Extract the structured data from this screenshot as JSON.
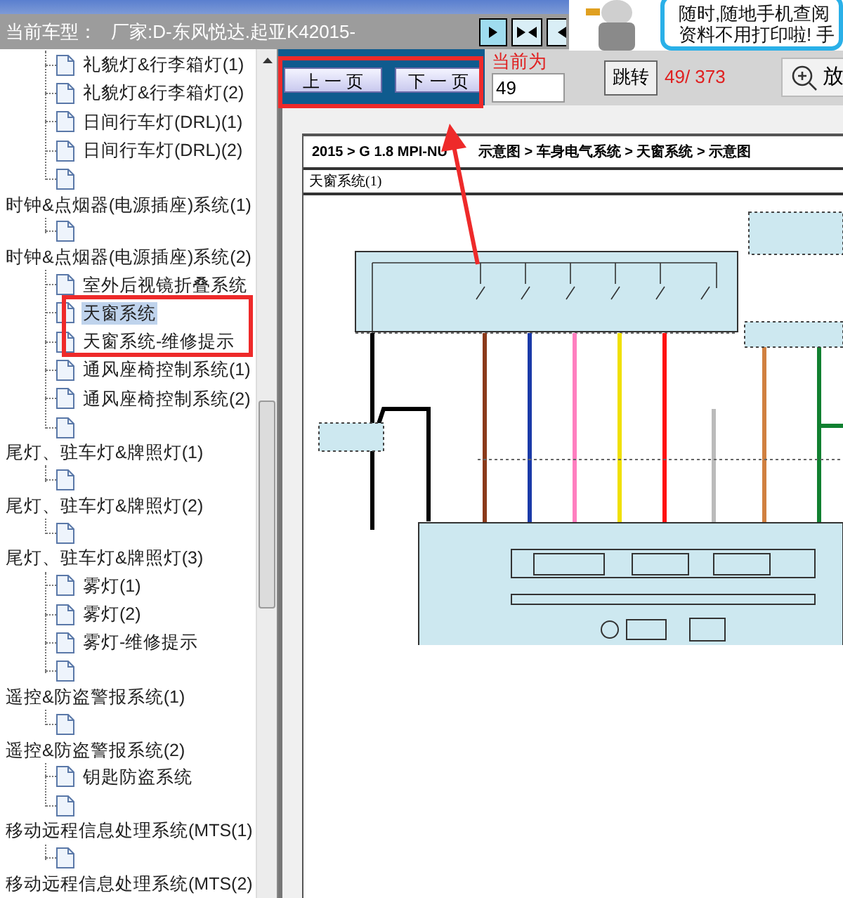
{
  "header": {
    "label": "当前车型：",
    "value": "厂家:D-东风悦达.起亚K42015-"
  },
  "ad": {
    "lines": [
      "随时,随地手机查阅",
      "资料不用打印啦! 手"
    ]
  },
  "tree": [
    {
      "children": [
        {
          "label": "礼貌灯&行李箱灯(1)",
          "selected": false
        },
        {
          "label": "礼貌灯&行李箱灯(2)",
          "selected": false
        },
        {
          "label": "日间行车灯(DRL)(1)",
          "selected": false
        },
        {
          "label": "日间行车灯(DRL)(2)",
          "selected": false
        },
        {
          "selected": false
        }
      ]
    },
    {
      "label": "时钟&点烟器(电源插座)系统(1)",
      "selected": false,
      "children": [
        {
          "selected": false
        }
      ]
    },
    {
      "label": "时钟&点烟器(电源插座)系统(2)",
      "selected": false,
      "children": [
        {
          "label": "室外后视镜折叠系统",
          "selected": false
        },
        {
          "label": "天窗系统",
          "selected": true
        },
        {
          "label": "天窗系统-维修提示",
          "selected": false
        },
        {
          "label": "通风座椅控制系统(1)",
          "selected": false
        },
        {
          "label": "通风座椅控制系统(2)",
          "selected": false
        },
        {
          "selected": false
        }
      ]
    },
    {
      "label": "尾灯、驻车灯&牌照灯(1)",
      "selected": false,
      "children": [
        {
          "selected": false
        }
      ]
    },
    {
      "label": "尾灯、驻车灯&牌照灯(2)",
      "selected": false,
      "children": [
        {
          "selected": false
        }
      ]
    },
    {
      "label": "尾灯、驻车灯&牌照灯(3)",
      "selected": false,
      "children": [
        {
          "label": "雾灯(1)",
          "selected": false
        },
        {
          "label": "雾灯(2)",
          "selected": false
        },
        {
          "label": "雾灯-维修提示",
          "selected": false
        },
        {
          "selected": false
        }
      ]
    },
    {
      "label": "遥控&防盗警报系统(1)",
      "selected": false,
      "children": [
        {
          "selected": false
        }
      ]
    },
    {
      "label": "遥控&防盗警报系统(2)",
      "selected": false,
      "children": [
        {
          "label": "钥匙防盗系统",
          "selected": false
        },
        {
          "selected": false
        }
      ]
    },
    {
      "label": "移动远程信息处理系统(MTS(1)",
      "selected": false,
      "children": [
        {
          "selected": false
        }
      ]
    },
    {
      "label": "移动远程信息处理系统(MTS(2)",
      "selected": false
    }
  ],
  "pager": {
    "prev_button": "上 一 页",
    "next_button": "下 一 页",
    "current_label": "当前为",
    "page_input": "49",
    "jump_button": "跳转",
    "page_count": "49/ 373",
    "zoom_button": "放"
  },
  "document": {
    "breadcrumb": [
      "2015 > G 1.8 MPI-NU",
      "示意图 > 车身电气系统 > 天窗系统 > 示意图"
    ],
    "title": "天窗系统(1)"
  }
}
